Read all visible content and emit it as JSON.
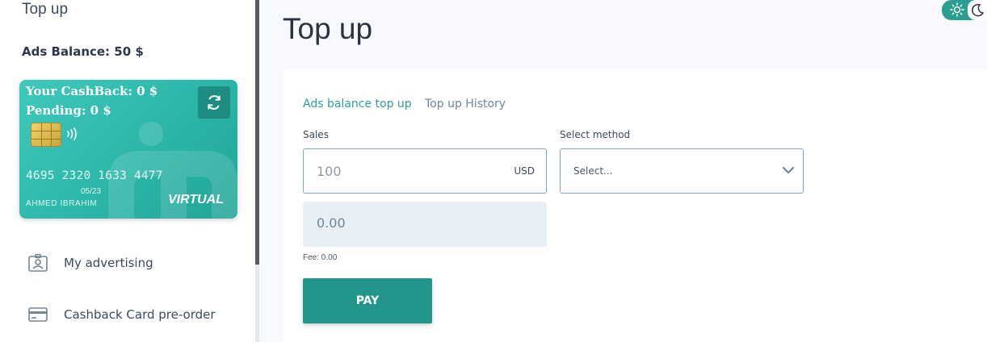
{
  "sidebar": {
    "title": "Top up",
    "ads_balance": "Ads Balance: 50 $",
    "card": {
      "cashback": "Your CashBack: 0 $",
      "pending": "Pending: 0 $",
      "number": "4695 2320 1633 4477",
      "expiry": "05/23",
      "holder": "AHMED IBRAHIM",
      "type": "VIRTUAL",
      "refresh_icon": "refresh-icon"
    },
    "nav": [
      {
        "label": "My advertising",
        "icon": "id-badge-icon"
      },
      {
        "label": "Cashback Card pre-order",
        "icon": "credit-card-icon"
      }
    ]
  },
  "main": {
    "title": "Top up",
    "tabs": [
      {
        "label": "Ads balance top up",
        "active": true
      },
      {
        "label": "Top up History",
        "active": false
      }
    ],
    "form": {
      "sales_label": "Sales",
      "sales_placeholder": "100",
      "currency": "USD",
      "method_label": "Select method",
      "method_value": "Select...",
      "total": "0.00",
      "fee": "Fee: 0.00",
      "pay_label": "PAY"
    }
  },
  "colors": {
    "accent": "#22968a",
    "card": "#2cb6a8",
    "tab_active": "#2f9f94"
  }
}
